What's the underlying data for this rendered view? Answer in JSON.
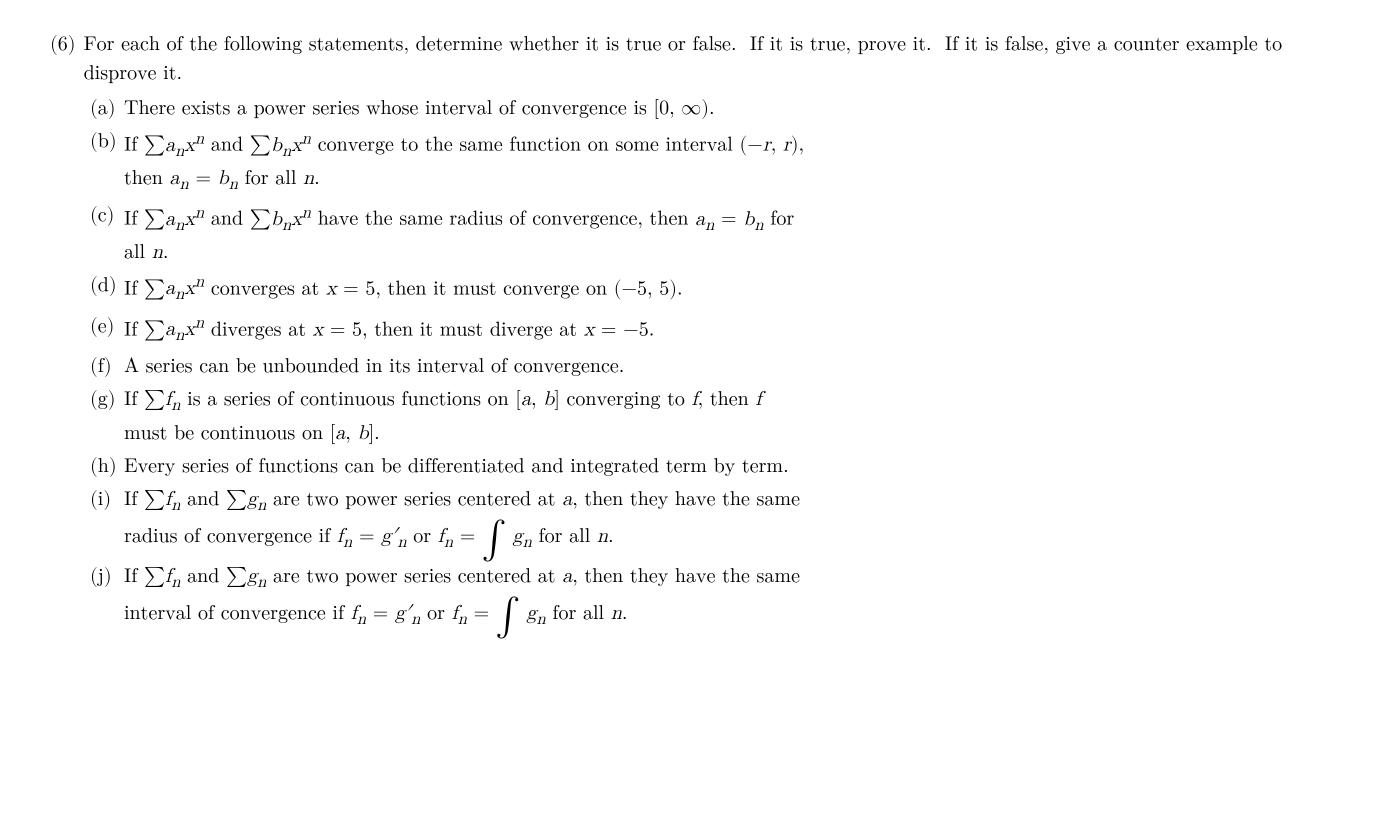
{
  "problem": {
    "number": "(6)",
    "intro": "For each of the following statements, determine whether it is true or false.  If it is true, prove it.  If it is false, give a counter example to disprove it.",
    "parts": [
      {
        "label": "(a)",
        "text": "There exists a power series whose interval of convergence is [0, ∞)."
      },
      {
        "label": "(b)",
        "line1": "If ∑aₙxⁿ and ∑bₙxⁿ converge to the same function on some interval (−r, r),",
        "line2": "then aₙ = bₙ for all n."
      },
      {
        "label": "(c)",
        "line1": "If ∑aₙxⁿ and ∑bₙxⁿ have the same radius of convergence, then aₙ = bₙ for",
        "line2": "all n."
      },
      {
        "label": "(d)",
        "text": "If ∑aₙxⁿ converges at x = 5, then it must converge on (−5, 5)."
      },
      {
        "label": "(e)",
        "text": "If ∑aₙxⁿ diverges at x = 5, then it must diverge at x = −5."
      },
      {
        "label": "(f)",
        "text": "A series can be unbounded in its interval of convergence."
      },
      {
        "label": "(g)",
        "line1": "If ∑fₙ is a series of continuous functions on [a, b] converging to f, then f",
        "line2": "must be continuous on [a, b]."
      },
      {
        "label": "(h)",
        "text": "Every series of functions can be differentiated and integrated term by term."
      },
      {
        "label": "(i)",
        "line1": "If ∑fₙ and ∑gₙ are two power series centered at a, then they have the same",
        "line2_pre": "radius of convergence if fₙ = g′ₙ or fₙ =",
        "line2_post": "gₙ for all n."
      },
      {
        "label": "(j)",
        "line1": "If ∑fₙ and ∑gₙ are two power series centered at a, then they have the same",
        "line2_pre": "interval of convergence if fₙ = g′ₙ or fₙ =",
        "line2_post": "gₙ for all n."
      }
    ]
  }
}
